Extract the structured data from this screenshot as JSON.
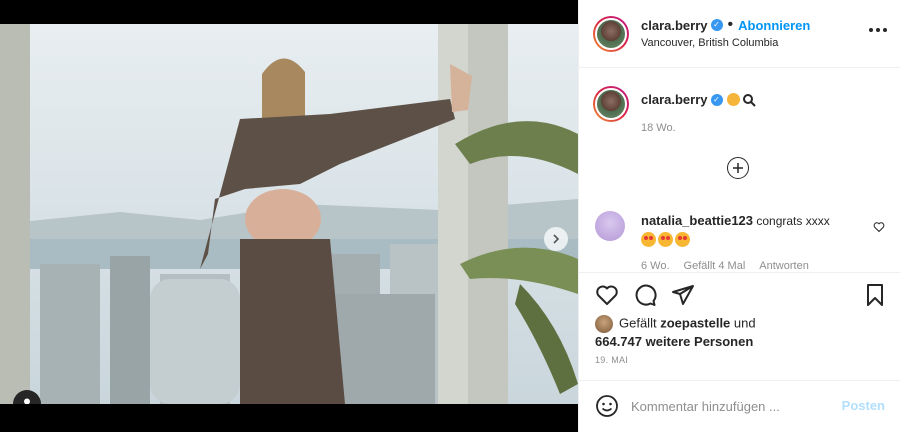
{
  "header": {
    "username": "clara.berry",
    "follow_label": "Abonnieren",
    "location": "Vancouver, British Columbia"
  },
  "caption": {
    "username": "clara.berry",
    "time": "18 Wo."
  },
  "comment": {
    "username": "natalia_beattie123",
    "text": "congrats xxxx",
    "meta_time": "6 Wo.",
    "meta_likes": "Gefällt 4 Mal",
    "meta_reply": "Antworten"
  },
  "likes": {
    "prefix": "Gefällt",
    "liker": "zoepastelle",
    "suffix": "und",
    "others": "664.747 weitere Personen"
  },
  "date": "19. MAI",
  "composer": {
    "placeholder": "Kommentar hinzufügen ...",
    "post_label": "Posten"
  },
  "carousel": {
    "slide_count": 2,
    "active_slide": 1
  },
  "colors": {
    "accent": "#0095f6",
    "verified": "#3897f0",
    "post_disabled": "#b2dffc",
    "muted": "#8e8e8e"
  },
  "icons": [
    "verified-icon",
    "more-options-icon",
    "add-comment-icon",
    "heart-icon",
    "comment-icon",
    "share-icon",
    "bookmark-icon",
    "emoji-icon",
    "chevron-right-icon",
    "user-tag-icon"
  ]
}
